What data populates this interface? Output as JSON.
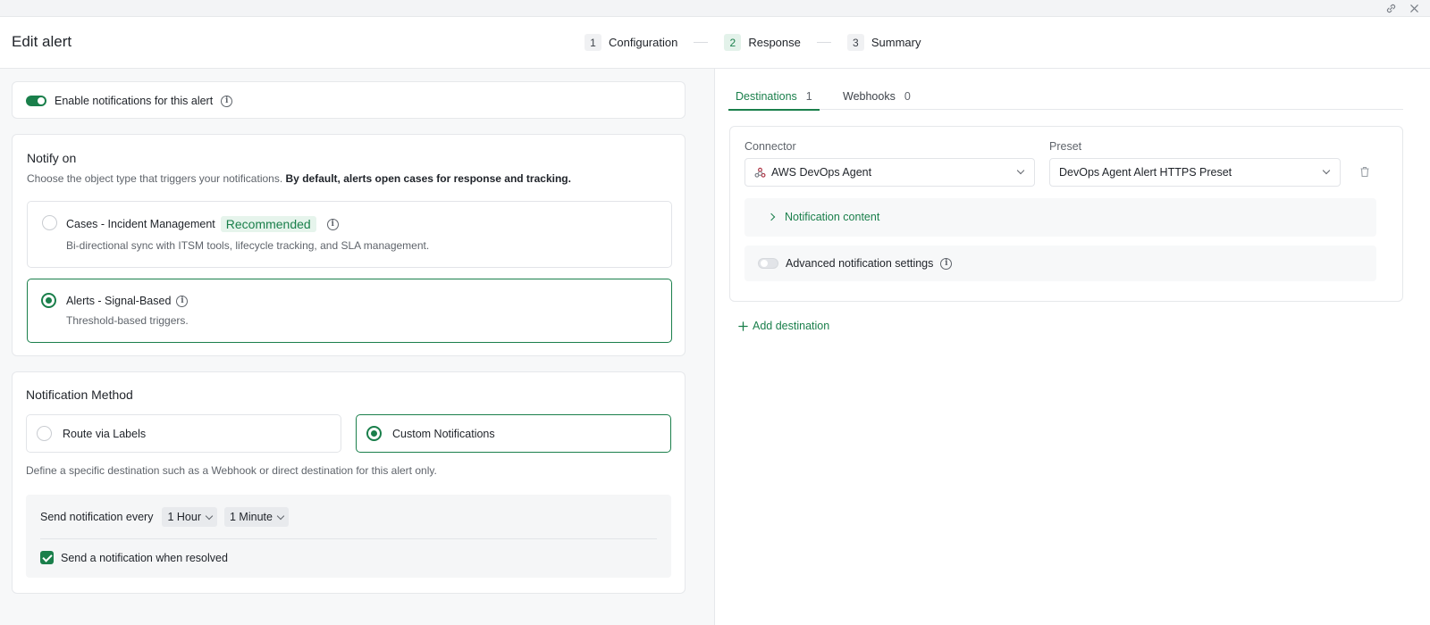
{
  "header": {
    "title": "Edit alert",
    "steps": [
      {
        "num": "1",
        "label": "Configuration"
      },
      {
        "num": "2",
        "label": "Response"
      },
      {
        "num": "3",
        "label": "Summary"
      }
    ]
  },
  "enable": {
    "label": "Enable notifications for this alert"
  },
  "notify_on": {
    "title": "Notify on",
    "desc": "Choose the object type that triggers your notifications.",
    "desc_bold": "By default, alerts open cases for response and tracking.",
    "options": [
      {
        "title": "Cases - Incident Management",
        "badge": "Recommended",
        "desc": "Bi-directional sync with ITSM tools, lifecycle tracking, and SLA management."
      },
      {
        "title": "Alerts - Signal-Based",
        "desc": "Threshold-based triggers."
      }
    ]
  },
  "method": {
    "title": "Notification Method",
    "options": [
      "Route via Labels",
      "Custom Notifications"
    ],
    "desc": "Define a specific destination such as a Webhook or direct destination for this alert only.",
    "send_every_label": "Send notification every",
    "hour_value": "1 Hour",
    "minute_value": "1 Minute",
    "resolved_label": "Send a notification when resolved"
  },
  "tabs": [
    {
      "label": "Destinations",
      "count": "1"
    },
    {
      "label": "Webhooks",
      "count": "0"
    }
  ],
  "destination": {
    "connector_label": "Connector",
    "connector_value": "AWS DevOps Agent",
    "preset_label": "Preset",
    "preset_value": "DevOps Agent Alert HTTPS Preset",
    "content_label": "Notification content",
    "advanced_label": "Advanced notification settings",
    "add_label": "Add destination"
  },
  "colors": {
    "accent": "#1a7f4b",
    "badge_bg": "#e6f4ec"
  }
}
